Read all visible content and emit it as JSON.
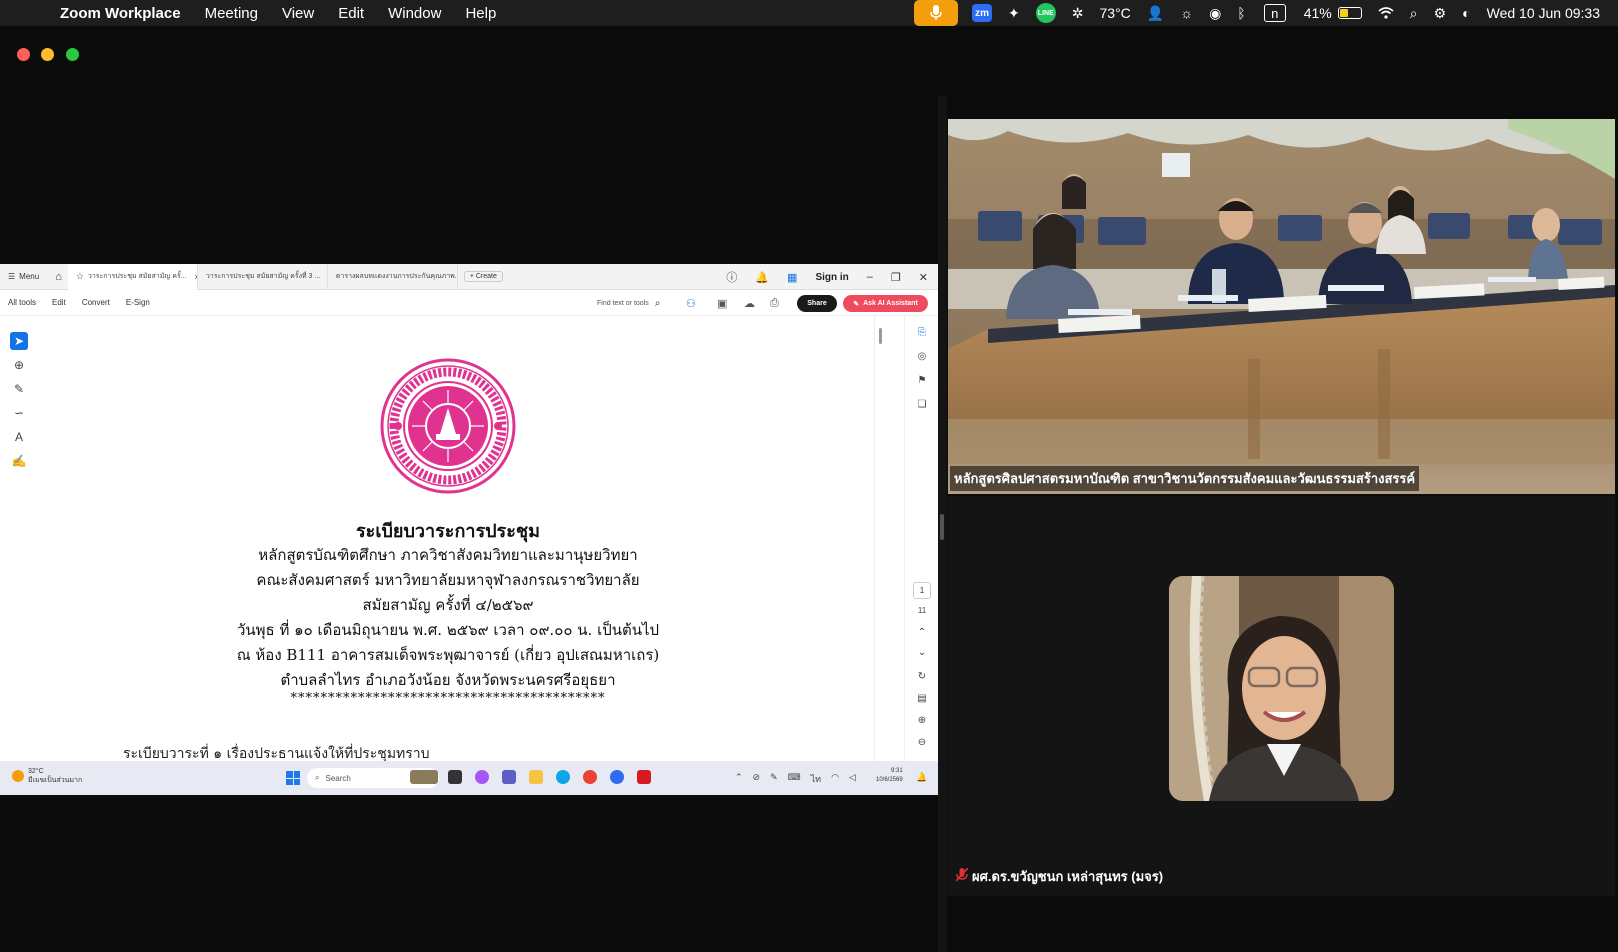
{
  "menubar": {
    "app_name": "Zoom Workplace",
    "menus": [
      "Meeting",
      "View",
      "Edit",
      "Window",
      "Help"
    ],
    "zoom_badge": "zm",
    "line_badge": "LINE",
    "temperature": "73°C",
    "n_box": "n",
    "battery_percent": "41%",
    "battery_level": 0.41,
    "datetime": "Wed 10 Jun  09:33"
  },
  "acrobat": {
    "menu_label": "Menu",
    "tabs": [
      {
        "label": "วาระการประชุม สมัยสามัญ ครั้...",
        "active": true
      },
      {
        "label": "วาระการประชุม สมัยสามัญ ครั้งที่ 3 ...",
        "active": false
      },
      {
        "label": "ตารางผลบทแดงงานการประกันคุณภาพ...",
        "active": false
      }
    ],
    "create_label": "+ Create",
    "sign_in": "Sign in",
    "toolbar": {
      "items": [
        "All tools",
        "Edit",
        "Convert",
        "E-Sign"
      ],
      "find_placeholder": "Find text or tools",
      "share": "Share",
      "ask_ai": "Ask AI Assistant"
    },
    "page_number": "1",
    "page_total": "11"
  },
  "document": {
    "seal_text": "ปัญญา โลกสฺมึ ปชฺโชโต",
    "title": "ระเบียบวาระการประชุม",
    "lines": [
      "หลักสูตรบัณฑิตศึกษา ภาควิชาสังคมวิทยาและมานุษยวิทยา",
      "คณะสังคมศาสตร์ มหาวิทยาลัยมหาจุฬาลงกรณราชวิทยาลัย",
      "สมัยสามัญ ครั้งที่ ๔/๒๕๖๙",
      "วันพุธ ที่ ๑๐ เดือนมิถุนายน พ.ศ. ๒๕๖๙ เวลา ๐๙.๐๐ น. เป็นต้นไป",
      "ณ ห้อง B111 อาคารสมเด็จพระพุฒาจารย์ (เกี่ยว อุปเสณมหาเถร)",
      "ตำบลลำไทร อำเภอวังน้อย จังหวัดพระนครศรีอยุธยา",
      "******************************************"
    ],
    "cut_line": "ระเบียบวาระที่ ๑  เรื่องประธานแจ้งให้ที่ประชุมทราบ"
  },
  "taskbar": {
    "weather_temp": "32°C",
    "weather_desc": "มีเมฆเป็นส่วนมาก",
    "search": "Search",
    "time": "9:31",
    "date": "10/6/2569"
  },
  "participants": {
    "tile1_name": "หลักสูตรศิลปศาสตรมหาบัณฑิต สาขาวิชานวัตกรรมสังคมและวัฒนธรรมสร้างสรรค์",
    "tile2_name": "ผศ.ดร.ขวัญชนก เหล่าสุนทร (มจร)"
  },
  "colors": {
    "menubar_bg": "#1e1e1e",
    "mic_accent": "#f59e0b",
    "acrobat_ai": "#ef4b5f",
    "seal": "#e0338f",
    "muted_icon": "#e03131"
  }
}
